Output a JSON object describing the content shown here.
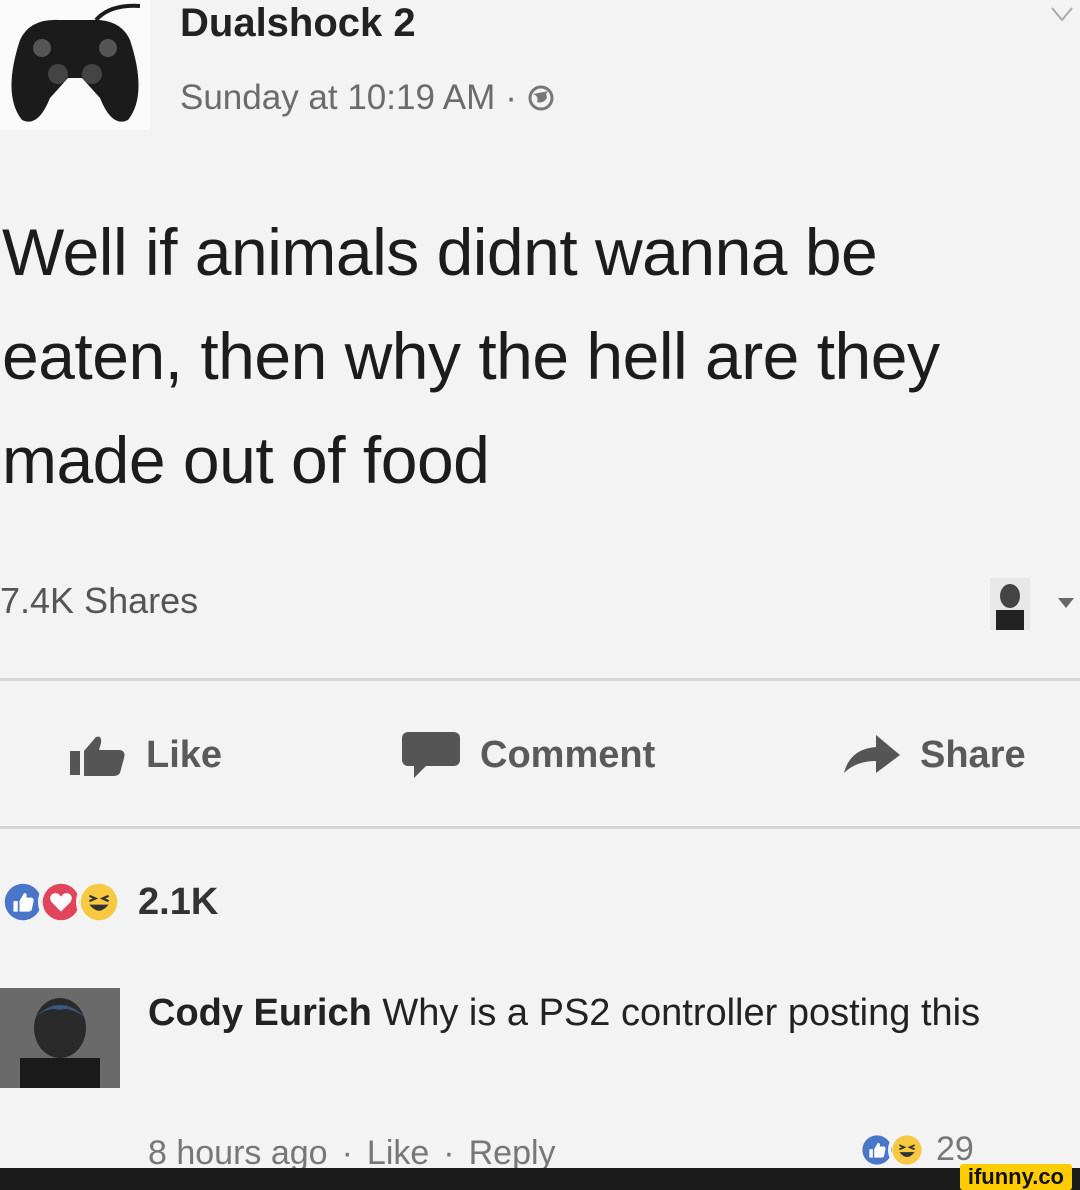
{
  "post": {
    "author": "Dualshock 2",
    "timestamp": "Sunday at 10:19 AM",
    "separator": "·",
    "privacy_icon": "globe-icon",
    "text": "Well if animals didnt wanna be eaten, then why the hell are they made out of food",
    "shares_label": "7.4K Shares"
  },
  "actions": {
    "like_label": "Like",
    "comment_label": "Comment",
    "share_label": "Share"
  },
  "reactions": {
    "icons": [
      "like-reaction-icon",
      "love-reaction-icon",
      "haha-reaction-icon"
    ],
    "count": "2.1K"
  },
  "comment": {
    "author": "Cody Eurich",
    "text": " Why is a PS2 controller posting this",
    "time": "8 hours ago",
    "dot": "·",
    "like_label": "Like",
    "reply_label": "Reply",
    "reaction_count": "29"
  },
  "watermark": "ifunny.co",
  "colors": {
    "background": "#f3f3f3",
    "like_blue": "#4a76c9",
    "love_red": "#e0455b",
    "haha_yellow": "#f7c842",
    "watermark_yellow": "#ffcc00"
  }
}
